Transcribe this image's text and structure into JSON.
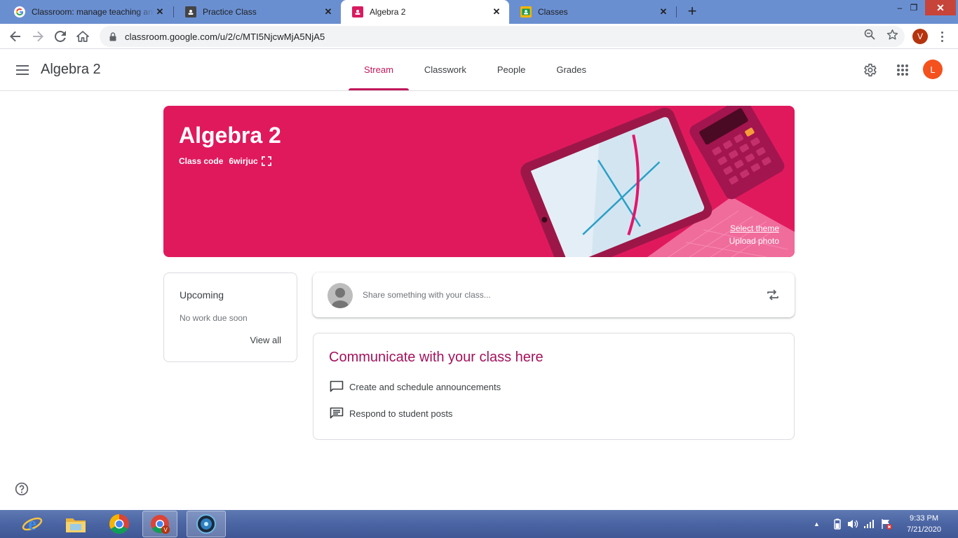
{
  "browser": {
    "tabs": [
      {
        "title": "Classroom: manage teaching and learning",
        "active": false,
        "favicon": "google-g-icon"
      },
      {
        "title": "Practice Class",
        "active": false,
        "favicon": "classroom-icon"
      },
      {
        "title": "Algebra 2",
        "active": true,
        "favicon": "classroom-icon"
      },
      {
        "title": "Classes",
        "active": false,
        "favicon": "classroom-icon"
      }
    ],
    "url": "classroom.google.com/u/2/c/MTI5NjcwMjA5NjA5",
    "profile_initial": "V",
    "window_controls": {
      "minimize": "–",
      "restore": "❐",
      "close": "✕"
    },
    "new_tab": "+"
  },
  "header": {
    "class_name": "Algebra 2",
    "tabs": [
      "Stream",
      "Classwork",
      "People",
      "Grades"
    ],
    "active_tab": "Stream",
    "account_initial": "L"
  },
  "banner": {
    "title": "Algebra 2",
    "class_code_label": "Class code",
    "class_code": "6wirjuc",
    "select_theme": "Select theme",
    "upload_photo": "Upload photo",
    "theme_color": "#e0195d"
  },
  "upcoming": {
    "title": "Upcoming",
    "empty_text": "No work due soon",
    "view_all": "View all"
  },
  "share": {
    "placeholder": "Share something with your class..."
  },
  "communicate": {
    "title": "Communicate with your class here",
    "items": [
      "Create and schedule announcements",
      "Respond to student posts"
    ]
  },
  "taskbar": {
    "apps": [
      "internet-explorer-icon",
      "file-explorer-icon",
      "chrome-icon",
      "chrome-profile-icon",
      "media-app-icon"
    ],
    "time": "9:33 PM",
    "date": "7/21/2020"
  },
  "colors": {
    "accent": "#c2185b",
    "tab_strip": "#6a8fd1",
    "avatar_l": "#f4511e",
    "avatar_v": "#b5340e"
  }
}
